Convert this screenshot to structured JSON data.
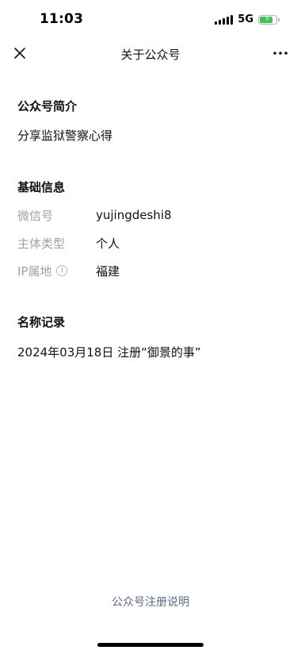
{
  "status_bar": {
    "time": "11:03",
    "network": "5G",
    "battery_level": 0.8,
    "battery_color": "#34c759"
  },
  "nav": {
    "title": "关于公众号",
    "close_icon": "close-icon",
    "more_icon": "more-icon"
  },
  "intro": {
    "title": "公众号简介",
    "text": "分享监狱警察心得"
  },
  "basic_info": {
    "title": "基础信息",
    "rows": [
      {
        "label": "微信号",
        "value": "yujingdeshi8"
      },
      {
        "label": "主体类型",
        "value": "个人"
      },
      {
        "label": "IP属地",
        "value": "福建"
      }
    ]
  },
  "name_records": {
    "title": "名称记录",
    "items": [
      "2024年03月18日 注册“御景的事”"
    ]
  },
  "footer": {
    "link_label": "公众号注册说明",
    "link_color": "#5b6b8c"
  }
}
